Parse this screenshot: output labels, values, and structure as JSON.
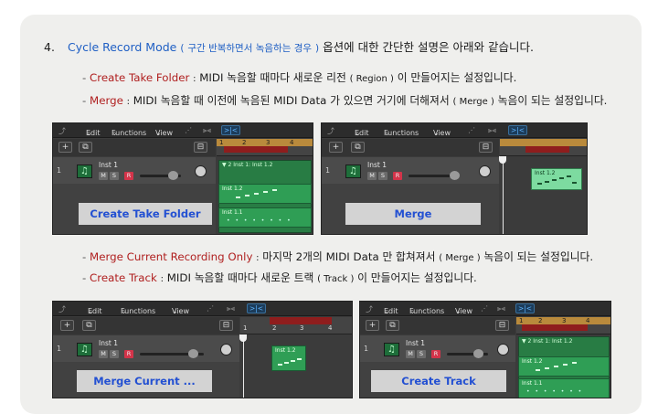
{
  "heading": {
    "number": "4.",
    "title": "Cycle Record Mode",
    "paren_open": "(",
    "korean_sub": "구간 반복하면서 녹음하는 경우",
    "paren_close": ")",
    "rest": "옵션에 대한 간단한 설명은 아래와 같습니다."
  },
  "bullets": [
    {
      "dash": "-",
      "term": "Create Take Folder",
      "sep": ":",
      "text": "MIDI 녹음할 때마다 새로운 리전",
      "paren": "( Region )",
      "tail": "이 만들어지는 설정입니다."
    },
    {
      "dash": "-",
      "term": "Merge",
      "sep": ":",
      "text": "MIDI 녹음할 때 이전에 녹음된 MIDI Data 가 있으면 거기에 더해져서",
      "paren": "( Merge )",
      "tail": "녹음이 되는 설정입니다."
    },
    {
      "dash": "-",
      "term": "Merge Current Recording Only",
      "sep": ":",
      "text": "마지막 2개의 MIDI Data 만 합쳐져서",
      "paren": "( Merge )",
      "tail": "녹음이 되는 설정입니다."
    },
    {
      "dash": "-",
      "term": "Create Track",
      "sep": ":",
      "text": "MIDI 녹음할 때마다 새로운 트랙",
      "paren": "( Track )",
      "tail": "이 만들어지는 설정입니다."
    }
  ],
  "toolbar": {
    "edit": "Edit",
    "functions": "Functions",
    "view": "View",
    "chev": "⌄",
    "back_icon": "⤴",
    "tool1": "⋰",
    "tool2": "⫸⫷",
    "tool3": ">|<",
    "menu_caret": "⌄"
  },
  "track": {
    "number": "1",
    "name": "Inst 1",
    "m": "M",
    "s": "S",
    "r": "R",
    "plus": "+",
    "folder_icon": "⧉",
    "collapse": "⊟"
  },
  "ruler": {
    "ticks": [
      "1",
      "2",
      "3",
      "4"
    ]
  },
  "panels": [
    {
      "label": "Create Take Folder",
      "regions": {
        "folder": "▼ 2  Inst 1: Inst 1.2",
        "take2": "Inst 1.2",
        "take1": "Inst 1.1"
      }
    },
    {
      "label": "Merge",
      "regions": {
        "main": "Inst 1.2"
      }
    },
    {
      "label": "Merge Current ...",
      "regions": {
        "main": "Inst 1.2"
      }
    },
    {
      "label": "Create Track",
      "regions": {
        "folder": "▼ 2  Inst 1: Inst 1.2",
        "take2": "Inst 1.2",
        "take1": "Inst 1.1"
      }
    }
  ],
  "colors": {
    "accent_blue": "#1f5fc4",
    "term_red": "#b02020",
    "region_green": "#2f9e55",
    "cycle_orange": "#b98a3c",
    "record_red": "#8f1d1d"
  }
}
